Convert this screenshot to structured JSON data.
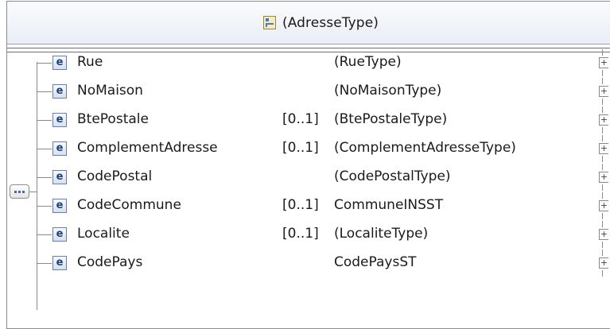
{
  "complex_type": {
    "title": "(AdresseType)",
    "icon": "complex-type-icon"
  },
  "compositor": {
    "icon": "sequence-icon"
  },
  "element_badge": "e",
  "expander_glyph": "+",
  "elements": [
    {
      "name": "Rue",
      "cardinality": "",
      "type": "(RueType)"
    },
    {
      "name": "NoMaison",
      "cardinality": "",
      "type": "(NoMaisonType)"
    },
    {
      "name": "BtePostale",
      "cardinality": "[0..1]",
      "type": "(BtePostaleType)"
    },
    {
      "name": "ComplementAdresse",
      "cardinality": "[0..1]",
      "type": "(ComplementAdresseType)"
    },
    {
      "name": "CodePostal",
      "cardinality": "",
      "type": "(CodePostalType)"
    },
    {
      "name": "CodeCommune",
      "cardinality": "[0..1]",
      "type": "CommuneINSST"
    },
    {
      "name": "Localite",
      "cardinality": "[0..1]",
      "type": "(LocaliteType)"
    },
    {
      "name": "CodePays",
      "cardinality": "",
      "type": "CodePaysST"
    }
  ]
}
